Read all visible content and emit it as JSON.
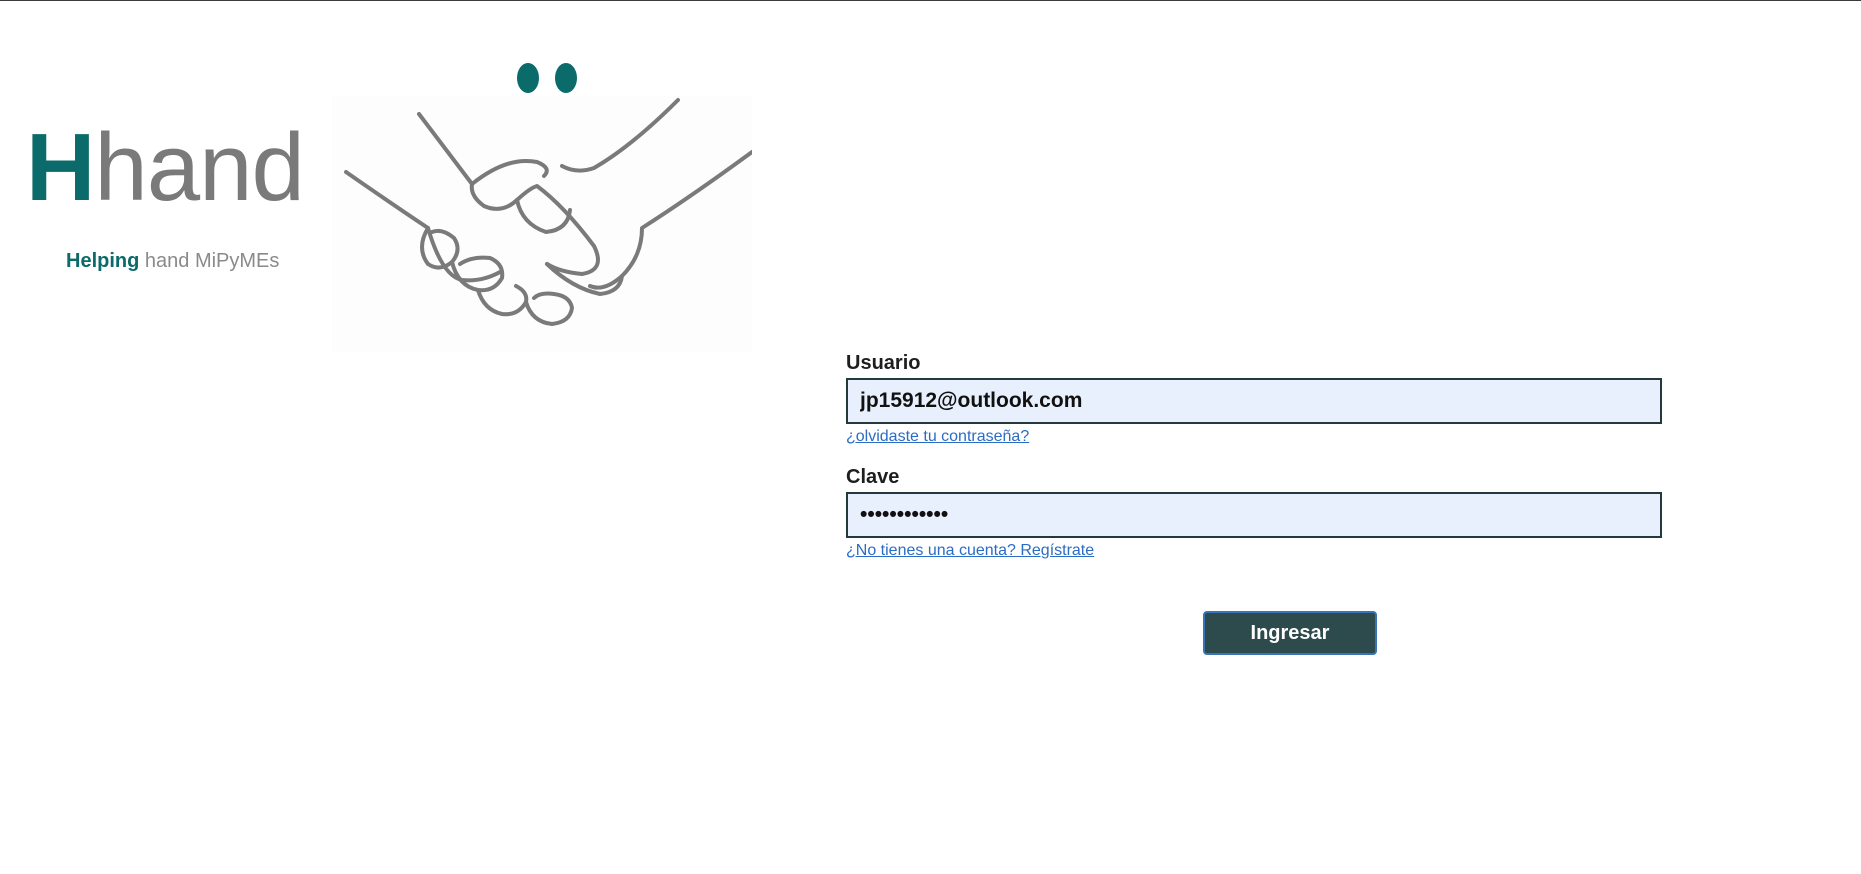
{
  "brand": {
    "logo_letter": "H",
    "logo_rest": "hand",
    "tagline_strong": "Helping",
    "tagline_rest": " hand MiPyMEs",
    "primary_color": "#0b6a6a",
    "secondary_color": "#7a7a7a",
    "illustration": "handshake-illustration"
  },
  "login": {
    "user_label": "Usuario",
    "user_value": "jp15912@outlook.com",
    "forgot_link": "¿olvidaste tu contraseña?",
    "password_label": "Clave",
    "password_value": "jp15912@outl",
    "register_link": "¿No tienes una cuenta? Regístrate",
    "submit_label": "Ingresar",
    "input_bg_color": "#e8f0fe",
    "button_color": "#2d4b4c",
    "link_color": "#2b6cc4"
  }
}
